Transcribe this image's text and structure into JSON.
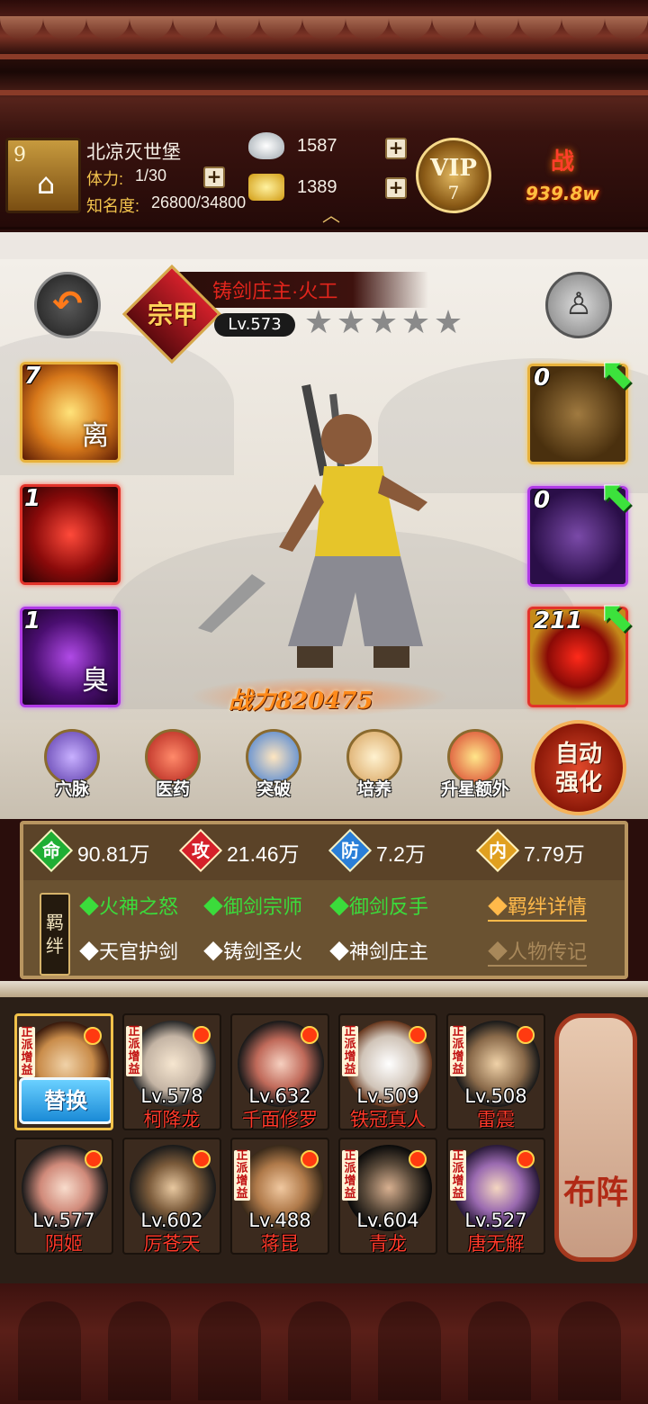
{
  "header": {
    "player_level": "9",
    "player_name": "北凉灭世堡",
    "stamina_label": "体力:",
    "stamina_value": "1/30",
    "fame_label": "知名度:",
    "fame_value": "26800/34800",
    "silver": "1587",
    "gold": "1389",
    "vip_label": "VIP",
    "vip_level": "7",
    "power_icon_text": "战",
    "power_total": "939.8w"
  },
  "hero": {
    "rank": "宗甲",
    "name": "铸剑庄主·火工",
    "level": "Lv.573",
    "stars_total": 5,
    "stars_filled": 0,
    "power_text": "战力820475"
  },
  "skills": [
    {
      "count": "7",
      "glyph": "离"
    },
    {
      "count": "1",
      "glyph": ""
    },
    {
      "count": "1",
      "glyph": "臭"
    }
  ],
  "equipment": [
    {
      "count": "0"
    },
    {
      "count": "0"
    },
    {
      "count": "211"
    }
  ],
  "functions": [
    {
      "label": "穴脉"
    },
    {
      "label": "医药"
    },
    {
      "label": "突破"
    },
    {
      "label": "培养"
    },
    {
      "label": "升星额外"
    }
  ],
  "auto_strengthen": {
    "line1": "自动",
    "line2": "强化"
  },
  "stats": [
    {
      "icon": "命",
      "value": "90.81万",
      "color": "#1fae34"
    },
    {
      "icon": "攻",
      "value": "21.46万",
      "color": "#d5202a"
    },
    {
      "icon": "防",
      "value": "7.2万",
      "color": "#2a7fd8"
    },
    {
      "icon": "内",
      "value": "7.79万",
      "color": "#e0a020"
    }
  ],
  "bonds": {
    "tag_line1": "羁",
    "tag_line2": "绊",
    "active": [
      "◆火神之怒",
      "◆御剑宗师",
      "◆御剑反手"
    ],
    "inactive": [
      "◆天官护剑",
      "◆铸剑圣火",
      "◆神剑庄主"
    ],
    "detail_link": "◆羁绊详情",
    "bio_link": "◆人物传记"
  },
  "team": {
    "replace_label": "替换",
    "buff_tag": "正派增益",
    "formation_label": "布阵",
    "members": [
      {
        "level": "",
        "name": "",
        "selected": true,
        "buff": true
      },
      {
        "level": "Lv.578",
        "name": "柯降龙",
        "buff": true
      },
      {
        "level": "Lv.632",
        "name": "千面修罗",
        "buff": false
      },
      {
        "level": "Lv.509",
        "name": "铁冠真人",
        "buff": true
      },
      {
        "level": "Lv.508",
        "name": "雷震",
        "buff": true
      },
      {
        "level": "Lv.577",
        "name": "阴姬",
        "buff": false
      },
      {
        "level": "Lv.602",
        "name": "厉苍天",
        "buff": false
      },
      {
        "level": "Lv.488",
        "name": "蒋昆",
        "buff": true
      },
      {
        "level": "Lv.604",
        "name": "青龙",
        "buff": true
      },
      {
        "level": "Lv.527",
        "name": "唐无解",
        "buff": true
      }
    ]
  }
}
